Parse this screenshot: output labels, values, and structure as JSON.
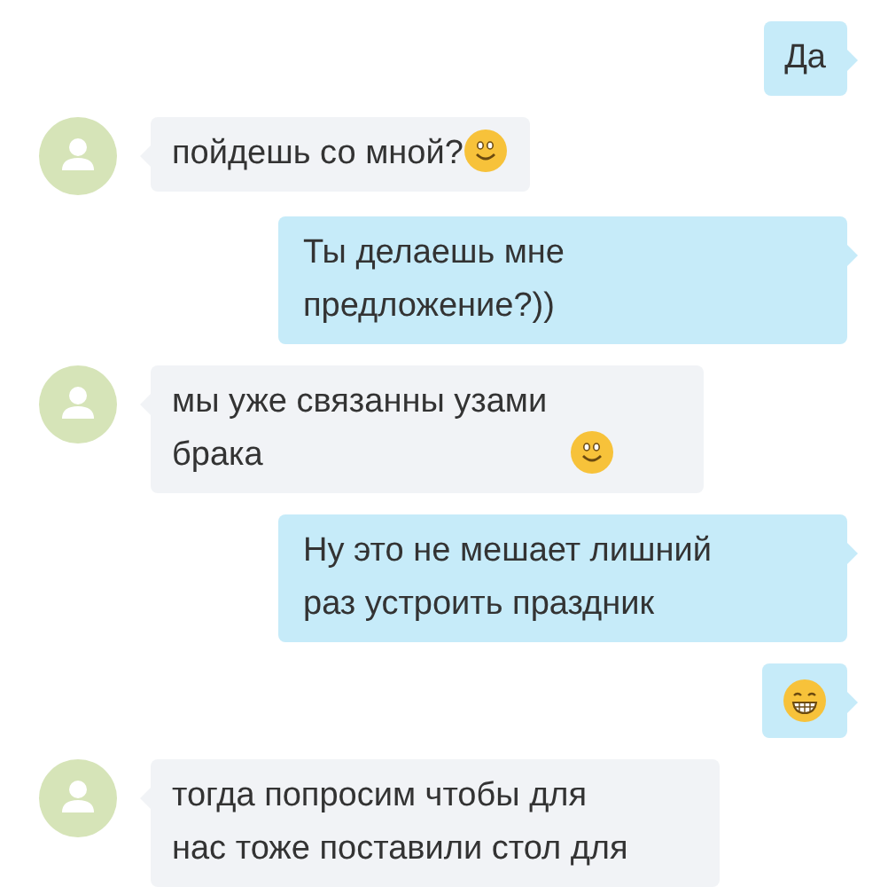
{
  "messages": [
    {
      "kind": "outgoing",
      "parts": [
        {
          "kind": "text",
          "text": "Да"
        }
      ]
    },
    {
      "kind": "incoming",
      "parts": [
        {
          "kind": "text",
          "text": "пойдешь со мной?"
        },
        {
          "kind": "smiley"
        }
      ]
    },
    {
      "kind": "outgoing",
      "parts": [
        {
          "kind": "text",
          "text": "Ты делаешь мне предложение?))"
        }
      ]
    },
    {
      "kind": "incoming",
      "parts": [
        {
          "kind": "text",
          "text": "мы уже связанны узами брака"
        },
        {
          "kind": "smiley"
        }
      ]
    },
    {
      "kind": "outgoing",
      "parts": [
        {
          "kind": "text",
          "text": "Ну это не мешает лишний раз устроить праздник"
        }
      ]
    },
    {
      "kind": "outgoing",
      "parts": [
        {
          "kind": "grin"
        }
      ]
    },
    {
      "kind": "incoming",
      "parts": [
        {
          "kind": "text",
          "text": "тогда попросим чтобы для нас тоже поставили стол для"
        }
      ]
    }
  ]
}
